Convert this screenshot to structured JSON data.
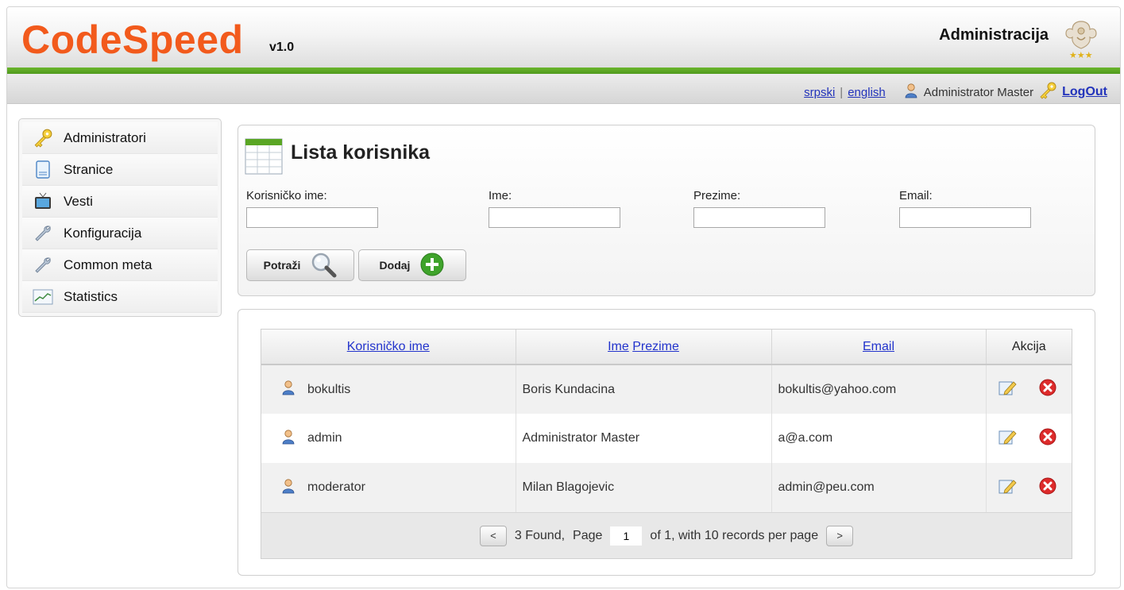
{
  "header": {
    "logo": "CodeSpeed",
    "version": "v1.0",
    "section_title": "Administracija"
  },
  "subbar": {
    "lang_sr": "srpski",
    "lang_separator": "|",
    "lang_en": "english",
    "user_name": "Administrator Master",
    "logout": "LogOut"
  },
  "sidebar": {
    "items": [
      {
        "label": "Administratori",
        "icon": "key-icon"
      },
      {
        "label": "Stranice",
        "icon": "page-icon"
      },
      {
        "label": "Vesti",
        "icon": "tv-icon"
      },
      {
        "label": "Konfiguracija",
        "icon": "wrench-icon"
      },
      {
        "label": "Common meta",
        "icon": "wrench-icon"
      },
      {
        "label": "Statistics",
        "icon": "chart-icon"
      }
    ]
  },
  "search": {
    "title": "Lista korisnika",
    "fields": [
      {
        "label": "Korisničko ime:",
        "value": ""
      },
      {
        "label": "Ime:",
        "value": ""
      },
      {
        "label": "Prezime:",
        "value": ""
      },
      {
        "label": "Email:",
        "value": ""
      }
    ],
    "search_button": "Potraži",
    "add_button": "Dodaj"
  },
  "table": {
    "columns": {
      "username": "Korisničko ime",
      "first_name": "Ime",
      "last_name": "Prezime",
      "email": "Email",
      "actions": "Akcija"
    },
    "rows": [
      {
        "username": "bokultis",
        "full_name": "Boris Kundacina",
        "email": "bokultis@yahoo.com"
      },
      {
        "username": "admin",
        "full_name": "Administrator Master",
        "email": "a@a.com"
      },
      {
        "username": "moderator",
        "full_name": "Milan Blagojevic",
        "email": "admin@peu.com"
      }
    ]
  },
  "pager": {
    "prev": "<",
    "next": ">",
    "found_text": "3 Found,",
    "page_label": "Page",
    "page_value": "1",
    "of_text": "of 1, with 10 records per page"
  },
  "colors": {
    "brand_orange": "#f25a1c",
    "accent_green": "#5aa624",
    "link_blue": "#2233cc"
  }
}
